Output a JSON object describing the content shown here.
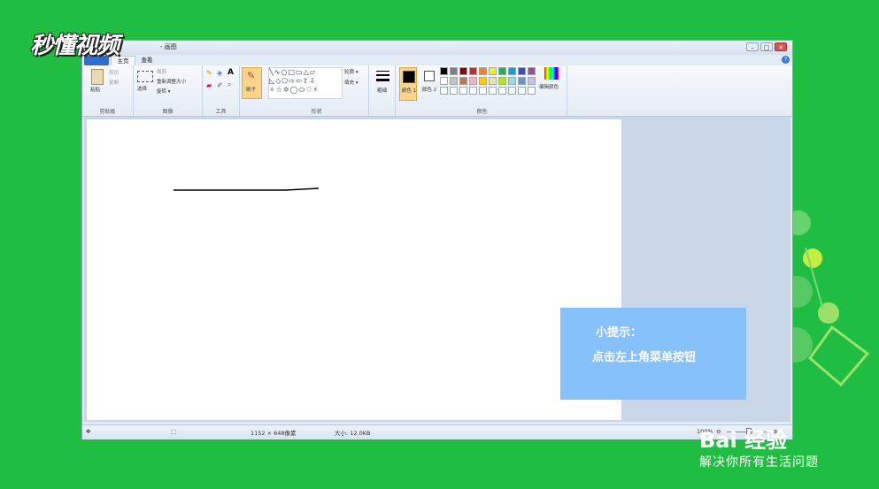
{
  "window": {
    "title": "- 画图",
    "min": "–",
    "max": "□",
    "close": "✕"
  },
  "tabs": [
    {
      "label": "主页"
    },
    {
      "label": "查看"
    }
  ],
  "help_icon": "?",
  "ribbon": {
    "clipboard": {
      "paste": "粘贴",
      "cut": "剪切",
      "copy": "复制",
      "label": "剪贴板"
    },
    "image": {
      "select": "选择",
      "crop": "裁剪",
      "resize": "重新调整大小",
      "rotate": "旋转 ▾",
      "label": "图像"
    },
    "tools": {
      "label": "工具",
      "text_glyph": "A"
    },
    "brushes": {
      "label": "刷子"
    },
    "shapes": {
      "outline": "轮廓 ▾",
      "fill": "填充 ▾",
      "label": "形状"
    },
    "size": {
      "label": "粗细"
    },
    "colors": {
      "color1": "颜色 1",
      "color2": "颜色 2",
      "edit": "编辑颜色",
      "label": "颜色",
      "color1_value": "#000000",
      "color2_value": "#ffffff",
      "palette_row1": [
        "#000000",
        "#7f7f7f",
        "#880015",
        "#ed1c24",
        "#ff7f27",
        "#fff200",
        "#22b14c",
        "#00a2e8",
        "#3f48cc",
        "#a349a4"
      ],
      "palette_row2": [
        "#ffffff",
        "#c3c3c3",
        "#b97a57",
        "#ffaec9",
        "#ffc90e",
        "#efe4b0",
        "#b5e61d",
        "#99d9ea",
        "#7092be",
        "#c8bfe7"
      ]
    }
  },
  "status": {
    "dimensions": "1152 × 648像素",
    "size": "大小: 12.0KB",
    "zoom": "100%",
    "zoom_out": "⊖",
    "zoom_in": "⊕",
    "move_icon": "✥"
  },
  "overlay": {
    "logo": "秒懂视频",
    "tip_title": "小提示：",
    "tip_body": "点击左上角菜单按钮",
    "brand": "Bai 经验",
    "slogan": "解决你所有生活问题"
  }
}
